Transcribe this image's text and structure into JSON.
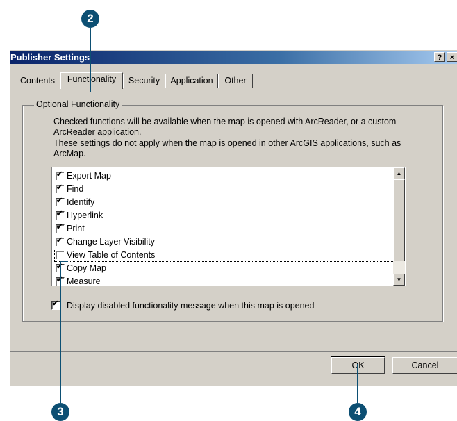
{
  "callouts": {
    "c2": "2",
    "c3": "3",
    "c4": "4"
  },
  "dialog": {
    "title": "Publisher Settings",
    "help_button": "?",
    "close_button": "×"
  },
  "tabs": [
    "Contents",
    "Functionality",
    "Security",
    "Application",
    "Other"
  ],
  "active_tab": "Functionality",
  "group": {
    "label": "Optional Functionality",
    "desc1": "Checked functions will be available when the map is opened with ArcReader, or a custom ArcReader application.",
    "desc2": "These settings do not apply when the map is opened in other ArcGIS applications, such as ArcMap."
  },
  "functions": [
    {
      "label": "Export Map",
      "checked": true
    },
    {
      "label": "Find",
      "checked": true
    },
    {
      "label": "Identify",
      "checked": true
    },
    {
      "label": "Hyperlink",
      "checked": true
    },
    {
      "label": "Print",
      "checked": true
    },
    {
      "label": "Change Layer Visibility",
      "checked": true
    },
    {
      "label": "View Table of Contents",
      "checked": false
    },
    {
      "label": "Copy Map",
      "checked": true
    },
    {
      "label": "Measure",
      "checked": true
    }
  ],
  "display_message": {
    "label": "Display disabled functionality message when this map is opened",
    "checked": true
  },
  "buttons": {
    "ok": "OK",
    "cancel": "Cancel"
  },
  "scroll": {
    "up": "▲",
    "down": "▼"
  },
  "check_glyph": "✔",
  "colors": {
    "callout": "#0c4f73",
    "titlebar": "#0a246a",
    "dialog_bg": "#d4d0c8"
  }
}
